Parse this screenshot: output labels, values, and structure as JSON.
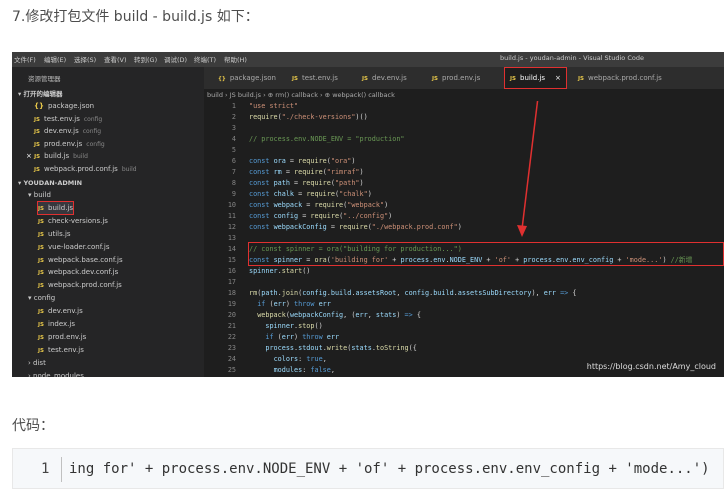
{
  "heading": "7.修改打包文件 build - build.js 如下：",
  "code_label": "代码：",
  "snippet": {
    "line_no": "1",
    "code": "ing for' + process.env.NODE_ENV + 'of' + process.env.env_config + 'mode...')"
  },
  "vscode": {
    "window_title": "build.js - youdan-admin - Visual Studio Code",
    "menu": [
      "文件(F)",
      "编辑(E)",
      "选择(S)",
      "查看(V)",
      "转到(G)",
      "调试(D)",
      "终端(T)",
      "帮助(H)"
    ],
    "explorer_title": "资源管理器",
    "open_editors_title": "打开的编辑器",
    "open_editors": [
      {
        "badge": "{}",
        "name": "package.json",
        "dim": ""
      },
      {
        "badge": "JS",
        "name": "test.env.js",
        "dim": "config"
      },
      {
        "badge": "JS",
        "name": "dev.env.js",
        "dim": "config"
      },
      {
        "badge": "JS",
        "name": "prod.env.js",
        "dim": "config"
      },
      {
        "badge": "JS",
        "name": "build.js",
        "dim": "build"
      },
      {
        "badge": "JS",
        "name": "webpack.prod.conf.js",
        "dim": "build"
      }
    ],
    "project_title": "YOUDAN-ADMIN",
    "tree": [
      {
        "name": "build",
        "folder": true,
        "indent": 1
      },
      {
        "name": "build.js",
        "badge": "JS",
        "indent": 2,
        "selected": true
      },
      {
        "name": "check-versions.js",
        "badge": "JS",
        "indent": 2
      },
      {
        "name": "utils.js",
        "badge": "JS",
        "indent": 2
      },
      {
        "name": "vue-loader.conf.js",
        "badge": "JS",
        "indent": 2
      },
      {
        "name": "webpack.base.conf.js",
        "badge": "JS",
        "indent": 2
      },
      {
        "name": "webpack.dev.conf.js",
        "badge": "JS",
        "indent": 2
      },
      {
        "name": "webpack.prod.conf.js",
        "badge": "JS",
        "indent": 2
      },
      {
        "name": "config",
        "folder": true,
        "indent": 1
      },
      {
        "name": "dev.env.js",
        "badge": "JS",
        "indent": 2
      },
      {
        "name": "index.js",
        "badge": "JS",
        "indent": 2
      },
      {
        "name": "prod.env.js",
        "badge": "JS",
        "indent": 2
      },
      {
        "name": "test.env.js",
        "badge": "JS",
        "indent": 2
      },
      {
        "name": "dist",
        "folder": true,
        "collapsed": true,
        "indent": 1
      },
      {
        "name": "node_modules",
        "folder": true,
        "collapsed": true,
        "indent": 1
      }
    ],
    "tabs": [
      {
        "badge": "{}",
        "name": "package.json"
      },
      {
        "badge": "JS",
        "name": "test.env.js"
      },
      {
        "badge": "JS",
        "name": "dev.env.js"
      },
      {
        "badge": "JS",
        "name": "prod.env.js"
      },
      {
        "badge": "JS",
        "name": "build.js",
        "active": true
      },
      {
        "badge": "JS",
        "name": "webpack.prod.conf.js"
      }
    ],
    "close_glyph": "×",
    "breadcrumb": "build › JS build.js › ⊕ rm() callback › ⊕ webpack() callback",
    "watermark": "https://blog.csdn.net/Amy_cloud"
  }
}
